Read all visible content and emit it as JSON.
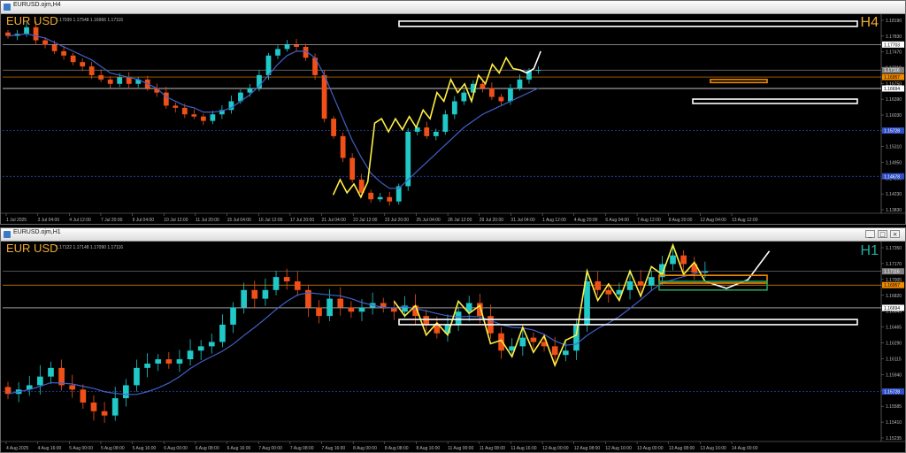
{
  "windows": [
    {
      "title": "EURUSD.ojm,H4",
      "symbol_label": "EUR USD",
      "timeframe_label": "H4",
      "timeframe_color": "#f0a830",
      "ohlc_text": "1.17039 1.17548 1.16966 1.17116",
      "price_ticks": [
        "1.18190",
        "1.17830",
        "1.17470",
        "1.17110",
        "1.16750",
        "1.16390",
        "1.16030",
        "1.15670",
        "1.15310",
        "1.14950",
        "1.14590",
        "1.14230",
        "1.13830"
      ],
      "marked_prices": [
        {
          "label": "1.17703",
          "bg": "#ffffff",
          "fg": "#000000",
          "line": "#cccccc"
        },
        {
          "label": "1.17116",
          "bg": "#808080",
          "fg": "#ffffff",
          "line": "#808080"
        },
        {
          "label": "1.16957",
          "bg": "#f08a00",
          "fg": "#000000",
          "line": "#f08a00"
        },
        {
          "label": "1.16694",
          "bg": "#ffffff",
          "fg": "#000000",
          "line": "#ffffff"
        },
        {
          "label": "1.15728",
          "bg": "#3050c8",
          "fg": "#ffffff",
          "line": "#3050c8"
        },
        {
          "label": "1.14678",
          "bg": "#3050c8",
          "fg": "#ffffff",
          "line": "#3050c8"
        }
      ],
      "time_ticks": [
        "1 Jul 2025",
        "3 Jul 04:00",
        "4 Jul 12:00",
        "7 Jul 20:00",
        "9 Jul 04:00",
        "10 Jul 12:00",
        "11 Jul 20:00",
        "15 Jul 04:00",
        "16 Jul 12:00",
        "17 Jul 20:00",
        "21 Jul 04:00",
        "22 Jul 12:00",
        "23 Jul 20:00",
        "25 Jul 04:00",
        "28 Jul 12:00",
        "29 Jul 20:00",
        "31 Jul 04:00",
        "1 Aug 12:00",
        "4 Aug 20:00",
        "6 Aug 04:00",
        "7 Aug 12:00",
        "8 Aug 20:00",
        "12 Aug 04:00",
        "13 Aug 12:00"
      ]
    },
    {
      "title": "EURUSD.ojm,H1",
      "symbol_label": "EUR USD",
      "timeframe_label": "H1",
      "timeframe_color": "#20b0a0",
      "ohlc_text": "1.17122 1.17148 1.17090 1.17116",
      "price_ticks": [
        "1.17350",
        "1.17170",
        "1.17005",
        "1.16820",
        "1.16645",
        "1.16465",
        "1.16290",
        "1.16115",
        "1.15940",
        "1.15760",
        "1.15585",
        "1.15410",
        "1.15235"
      ],
      "marked_prices": [
        {
          "label": "1.17116",
          "bg": "#808080",
          "fg": "#ffffff",
          "line": "#808080"
        },
        {
          "label": "1.16957",
          "bg": "#f08a00",
          "fg": "#000000",
          "line": "#f08a00"
        },
        {
          "label": "1.16694",
          "bg": "#ffffff",
          "fg": "#000000",
          "line": "#ffffff"
        },
        {
          "label": "1.15728",
          "bg": "#3050c8",
          "fg": "#ffffff",
          "line": "#3050c8"
        }
      ],
      "time_ticks": [
        "4 Aug 2025",
        "4 Aug 16:00",
        "5 Aug 00:00",
        "5 Aug 08:00",
        "5 Aug 16:00",
        "6 Aug 00:00",
        "6 Aug 08:00",
        "6 Aug 16:00",
        "7 Aug 00:00",
        "7 Aug 08:00",
        "7 Aug 16:00",
        "8 Aug 00:00",
        "8 Aug 08:00",
        "8 Aug 16:00",
        "11 Aug 00:00",
        "11 Aug 08:00",
        "11 Aug 16:00",
        "12 Aug 00:00",
        "12 Aug 08:00",
        "12 Aug 16:00",
        "13 Aug 00:00",
        "13 Aug 08:00",
        "13 Aug 16:00",
        "14 Aug 00:00"
      ]
    }
  ],
  "colors": {
    "bull": "#20c8c8",
    "bear": "#f05018",
    "ma": "#4060c8",
    "zigzag": "#ffee44",
    "projection": "#ffffff",
    "background": "#000000"
  },
  "chart_data": [
    {
      "type": "candlestick",
      "title": "EURUSD.ojm,H4",
      "ylim": [
        1.1383,
        1.1838
      ],
      "close_approx": [
        1.179,
        1.1795,
        1.181,
        1.178,
        1.177,
        1.1755,
        1.1745,
        1.173,
        1.172,
        1.17,
        1.169,
        1.168,
        1.1695,
        1.168,
        1.169,
        1.167,
        1.166,
        1.163,
        1.1625,
        1.161,
        1.1605,
        1.1595,
        1.161,
        1.162,
        1.164,
        1.166,
        1.167,
        1.17,
        1.1745,
        1.176,
        1.177,
        1.1765,
        1.174,
        1.17,
        1.16,
        1.156,
        1.151,
        1.146,
        1.143,
        1.1415,
        1.142,
        1.141,
        1.1445,
        1.157,
        1.158,
        1.156,
        1.157,
        1.161,
        1.164,
        1.166,
        1.168,
        1.167,
        1.165,
        1.164,
        1.167,
        1.169,
        1.171,
        1.1712
      ],
      "ma_approx": [
        1.179,
        1.1792,
        1.1795,
        1.179,
        1.1785,
        1.1775,
        1.1765,
        1.1755,
        1.1745,
        1.1735,
        1.172,
        1.1705,
        1.17,
        1.1695,
        1.169,
        1.168,
        1.167,
        1.165,
        1.164,
        1.163,
        1.1625,
        1.1615,
        1.1615,
        1.1618,
        1.1625,
        1.164,
        1.1655,
        1.1675,
        1.17,
        1.1725,
        1.1745,
        1.1755,
        1.1755,
        1.174,
        1.17,
        1.165,
        1.16,
        1.155,
        1.151,
        1.1475,
        1.1455,
        1.144,
        1.144,
        1.146,
        1.148,
        1.15,
        1.152,
        1.154,
        1.156,
        1.158,
        1.1595,
        1.161,
        1.162,
        1.163,
        1.164,
        1.165,
        1.166,
        1.167
      ],
      "zigzag_approx": [
        [
          47,
          1.1425
        ],
        [
          48,
          1.146
        ],
        [
          49,
          1.143
        ],
        [
          50,
          1.145
        ],
        [
          51,
          1.142
        ],
        [
          52,
          1.1455
        ],
        [
          53,
          1.159
        ],
        [
          54,
          1.16
        ],
        [
          55,
          1.157
        ],
        [
          56,
          1.16
        ],
        [
          57,
          1.1575
        ],
        [
          58,
          1.1605
        ],
        [
          59,
          1.158
        ],
        [
          60,
          1.162
        ],
        [
          61,
          1.16
        ],
        [
          62,
          1.166
        ],
        [
          63,
          1.164
        ],
        [
          64,
          1.169
        ],
        [
          65,
          1.166
        ],
        [
          66,
          1.168
        ],
        [
          67,
          1.164
        ],
        [
          68,
          1.17
        ],
        [
          69,
          1.168
        ],
        [
          70,
          1.1725
        ],
        [
          71,
          1.1705
        ],
        [
          72,
          1.174
        ],
        [
          73,
          1.1715
        ],
        [
          74,
          1.1712
        ]
      ],
      "projection_approx": [
        [
          74,
          1.1712
        ],
        [
          75,
          1.1705
        ],
        [
          76,
          1.1715
        ],
        [
          77,
          1.1755
        ]
      ],
      "zones": [
        {
          "color": "#ffffff",
          "from": 1.1812,
          "to": 1.1824,
          "span": "wide"
        },
        {
          "color": "#f08a00",
          "from": 1.1683,
          "to": 1.169,
          "span": "narrow"
        },
        {
          "color": "#ffffff",
          "from": 1.1635,
          "to": 1.1645,
          "span": "medium"
        }
      ],
      "horizontal_levels": [
        1.17703,
        1.17116,
        1.16957,
        1.16694,
        1.15728,
        1.14678
      ]
    },
    {
      "type": "candlestick",
      "title": "EURUSD.ojm,H1",
      "ylim": [
        1.1515,
        1.1745
      ],
      "close_approx": [
        1.157,
        1.1575,
        1.158,
        1.159,
        1.16,
        1.158,
        1.1575,
        1.156,
        1.155,
        1.1545,
        1.1565,
        1.158,
        1.16,
        1.1605,
        1.161,
        1.1605,
        1.161,
        1.162,
        1.1625,
        1.163,
        1.165,
        1.167,
        1.169,
        1.168,
        1.169,
        1.1705,
        1.17,
        1.169,
        1.167,
        1.166,
        1.168,
        1.167,
        1.1665,
        1.167,
        1.1675,
        1.167,
        1.1665,
        1.1672,
        1.166,
        1.165,
        1.164,
        1.165,
        1.1665,
        1.1675,
        1.166,
        1.164,
        1.162,
        1.1625,
        1.1635,
        1.163,
        1.1625,
        1.1615,
        1.162,
        1.165,
        1.17,
        1.169,
        1.1685,
        1.169,
        1.17,
        1.1695,
        1.1705,
        1.172,
        1.173,
        1.172,
        1.171,
        1.1712
      ],
      "zones": [
        {
          "color": "#f08a00",
          "from": 1.1698,
          "to": 1.1707,
          "span": "narrow"
        },
        {
          "color": "#20a060",
          "from": 1.169,
          "to": 1.17,
          "span": "narrow"
        },
        {
          "color": "#ffffff",
          "from": 1.165,
          "to": 1.1656,
          "span": "wide"
        }
      ],
      "horizontal_levels": [
        1.17116,
        1.16957,
        1.16694,
        1.15728
      ]
    }
  ]
}
